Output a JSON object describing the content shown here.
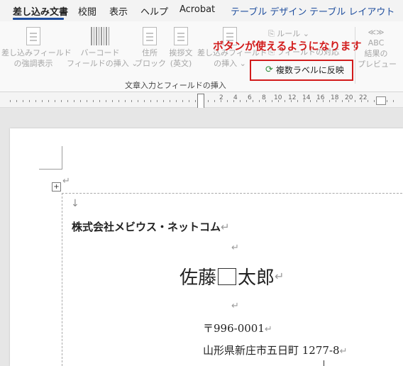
{
  "tabs": {
    "mailings": "差し込み文書",
    "review": "校閲",
    "view": "表示",
    "help": "ヘルプ",
    "acrobat": "Acrobat",
    "table_design": "テーブル デザイン",
    "table_layout": "テーブル レイアウト"
  },
  "ribbon": {
    "highlight_merge": [
      "差し込みフィールド",
      "の強調表示"
    ],
    "barcode_field": [
      "バーコード",
      "フィールドの挿入 ⌄"
    ],
    "address_block": [
      "住所",
      "ブロック"
    ],
    "greeting": [
      "挨拶文",
      "(英文)"
    ],
    "insert_merge_field": [
      "差し込みフィールド",
      "の挿入 ⌄"
    ],
    "rules": "ルール ⌄",
    "match_fields": "フィールドの対応",
    "update_labels": "複数ラベルに反映",
    "preview_results": [
      "≪≫",
      "ABC",
      "結果の",
      "プレビュー"
    ],
    "group_label": "文章入力とフィールドの挿入"
  },
  "annotation": "ボタンが使えるようになります",
  "ruler": {
    "marks": [
      "2",
      "4",
      "6",
      "8",
      "10",
      "12",
      "14",
      "16",
      "18",
      "20",
      "22"
    ]
  },
  "document": {
    "paragraph_mark": "↵",
    "cell_arrow": "↓",
    "move_handle": "+",
    "company": "株式会社メビウス・ネットコム",
    "name_last": "佐藤",
    "name_first": "太郎",
    "zip": "〒996-0001",
    "address": "山形県新庄市五日町 1277-8"
  }
}
